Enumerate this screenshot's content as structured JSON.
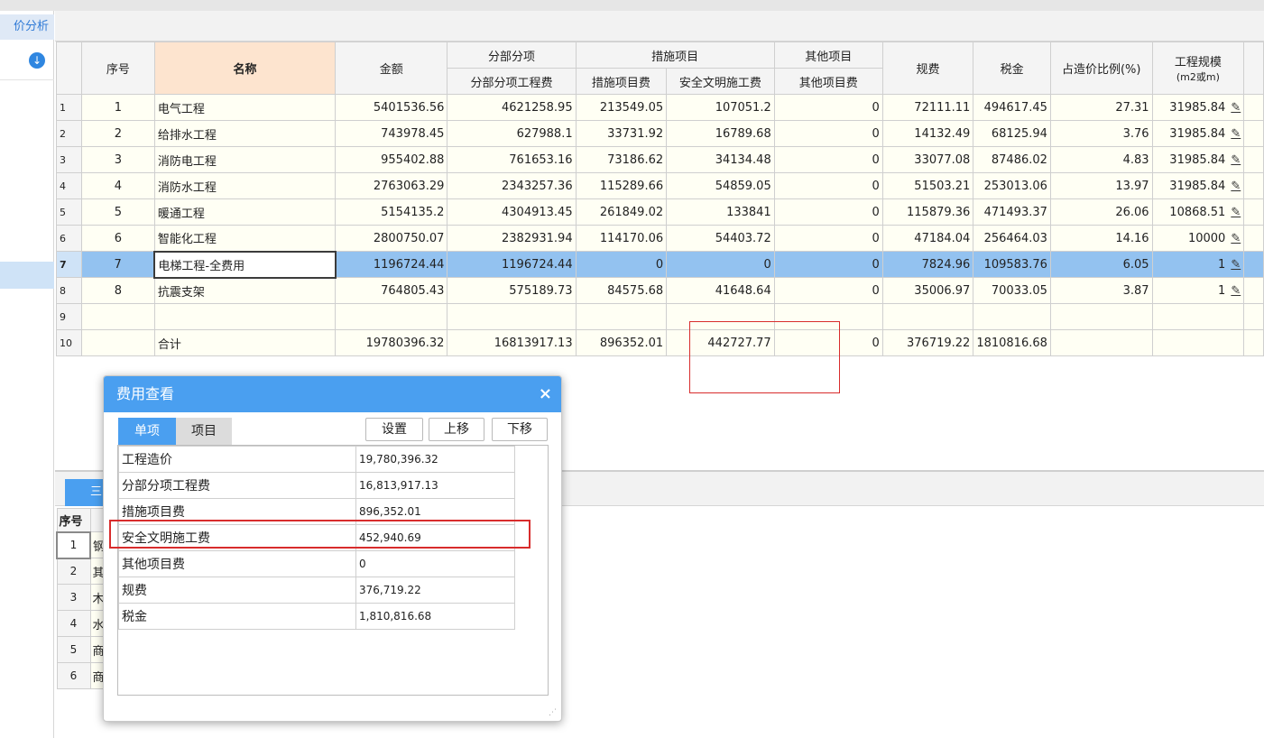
{
  "left_panel": {
    "tab_label": "价分析",
    "download_icon": "download-icon"
  },
  "main_table": {
    "headers": {
      "seq": "序号",
      "name": "名称",
      "amount": "金额",
      "group_fbfx": "分部分项",
      "fbfx_fee": "分部分项工程费",
      "group_csxm": "措施项目",
      "csxm_fee": "措施项目费",
      "aqwm_fee": "安全文明施工费",
      "group_qtxm": "其他项目",
      "qtxm_fee": "其他项目费",
      "guifei": "规费",
      "shuijin": "税金",
      "ratio": "占造价比例(%)",
      "scale_line1": "工程规模",
      "scale_line2": "(m2或m)"
    },
    "rows": [
      {
        "rn": "1",
        "seq": "1",
        "name": "电气工程",
        "amount": "5401536.56",
        "fbfx": "4621258.95",
        "csxm": "213549.05",
        "aqwm": "107051.2",
        "qtxm": "0",
        "guifei": "72111.11",
        "shuijin": "494617.45",
        "ratio": "27.31",
        "scale": "31985.84"
      },
      {
        "rn": "2",
        "seq": "2",
        "name": "给排水工程",
        "amount": "743978.45",
        "fbfx": "627988.1",
        "csxm": "33731.92",
        "aqwm": "16789.68",
        "qtxm": "0",
        "guifei": "14132.49",
        "shuijin": "68125.94",
        "ratio": "3.76",
        "scale": "31985.84"
      },
      {
        "rn": "3",
        "seq": "3",
        "name": "消防电工程",
        "amount": "955402.88",
        "fbfx": "761653.16",
        "csxm": "73186.62",
        "aqwm": "34134.48",
        "qtxm": "0",
        "guifei": "33077.08",
        "shuijin": "87486.02",
        "ratio": "4.83",
        "scale": "31985.84"
      },
      {
        "rn": "4",
        "seq": "4",
        "name": "消防水工程",
        "amount": "2763063.29",
        "fbfx": "2343257.36",
        "csxm": "115289.66",
        "aqwm": "54859.05",
        "qtxm": "0",
        "guifei": "51503.21",
        "shuijin": "253013.06",
        "ratio": "13.97",
        "scale": "31985.84"
      },
      {
        "rn": "5",
        "seq": "5",
        "name": "暖通工程",
        "amount": "5154135.2",
        "fbfx": "4304913.45",
        "csxm": "261849.02",
        "aqwm": "133841",
        "qtxm": "0",
        "guifei": "115879.36",
        "shuijin": "471493.37",
        "ratio": "26.06",
        "scale": "10868.51"
      },
      {
        "rn": "6",
        "seq": "6",
        "name": "智能化工程",
        "amount": "2800750.07",
        "fbfx": "2382931.94",
        "csxm": "114170.06",
        "aqwm": "54403.72",
        "qtxm": "0",
        "guifei": "47184.04",
        "shuijin": "256464.03",
        "ratio": "14.16",
        "scale": "10000"
      },
      {
        "rn": "7",
        "seq": "7",
        "name": "电梯工程-全费用",
        "amount": "1196724.44",
        "fbfx": "1196724.44",
        "csxm": "0",
        "aqwm": "0",
        "qtxm": "0",
        "guifei": "7824.96",
        "shuijin": "109583.76",
        "ratio": "6.05",
        "scale": "1"
      },
      {
        "rn": "8",
        "seq": "8",
        "name": "抗震支架",
        "amount": "764805.43",
        "fbfx": "575189.73",
        "csxm": "84575.68",
        "aqwm": "41648.64",
        "qtxm": "0",
        "guifei": "35006.97",
        "shuijin": "70033.05",
        "ratio": "3.87",
        "scale": "1"
      },
      {
        "rn": "9",
        "seq": "",
        "name": "",
        "amount": "",
        "fbfx": "",
        "csxm": "",
        "aqwm": "",
        "qtxm": "",
        "guifei": "",
        "shuijin": "",
        "ratio": "",
        "scale": ""
      },
      {
        "rn": "10",
        "seq": "",
        "name": "合计",
        "amount": "19780396.32",
        "fbfx": "16813917.13",
        "csxm": "896352.01",
        "aqwm": "442727.77",
        "qtxm": "0",
        "guifei": "376719.22",
        "shuijin": "1810816.68",
        "ratio": "",
        "scale": ""
      }
    ],
    "selected_row_index": 6,
    "pencil_glyph": "✎"
  },
  "bottom_panel": {
    "tab_label": "三",
    "header_seq": "序号",
    "rows": [
      {
        "n": "1",
        "t": "钢"
      },
      {
        "n": "2",
        "t": "其"
      },
      {
        "n": "3",
        "t": "木"
      },
      {
        "n": "4",
        "t": "水"
      },
      {
        "n": "5",
        "t": "商"
      },
      {
        "n": "6",
        "t": "商"
      }
    ]
  },
  "dialog": {
    "title": "费用查看",
    "close_glyph": "×",
    "tab_single": "单项",
    "tab_project": "项目",
    "btn_settings": "设置",
    "btn_up": "上移",
    "btn_down": "下移",
    "fees": [
      {
        "label": "工程造价",
        "value": "19,780,396.32"
      },
      {
        "label": "分部分项工程费",
        "value": "16,813,917.13"
      },
      {
        "label": "措施项目费",
        "value": "896,352.01"
      },
      {
        "label": "安全文明施工费",
        "value": "452,940.69"
      },
      {
        "label": "其他项目费",
        "value": "0"
      },
      {
        "label": "规费",
        "value": "376,719.22"
      },
      {
        "label": "税金",
        "value": "1,810,816.68"
      }
    ]
  },
  "colors": {
    "accent_blue": "#4a9ff0",
    "name_header_bg": "#fde4cf",
    "selected_row_bg": "#93c2f0",
    "highlight_red": "#d82c2c",
    "cell_bg": "#fffff4"
  }
}
